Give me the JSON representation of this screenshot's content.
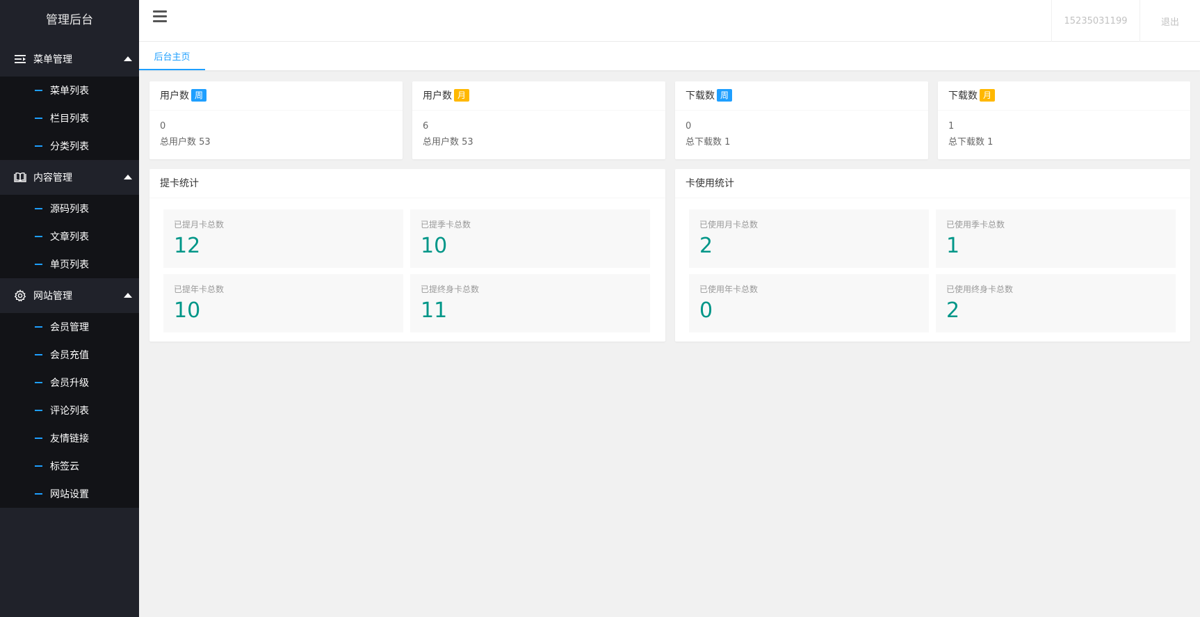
{
  "app": {
    "title": "管理后台"
  },
  "sidebar": {
    "groups": [
      {
        "label": "菜单管理",
        "icon": "menu-list-icon",
        "items": [
          "菜单列表",
          "栏目列表",
          "分类列表"
        ]
      },
      {
        "label": "内容管理",
        "icon": "book-icon",
        "items": [
          "源码列表",
          "文章列表",
          "单页列表"
        ]
      },
      {
        "label": "网站管理",
        "icon": "gear-icon",
        "items": [
          "会员管理",
          "会员充值",
          "会员升级",
          "评论列表",
          "友情链接",
          "标签云",
          "网站设置"
        ]
      }
    ]
  },
  "header": {
    "user": "15235031199",
    "logout": "退出"
  },
  "tabs": {
    "active": "后台主页"
  },
  "stats": [
    {
      "title": "用户数",
      "badge": "周",
      "badge_color": "#1e9fff",
      "value": "0",
      "total": "总用户数 53"
    },
    {
      "title": "用户数",
      "badge": "月",
      "badge_color": "#ffb800",
      "value": "6",
      "total": "总用户数 53"
    },
    {
      "title": "下载数",
      "badge": "周",
      "badge_color": "#1e9fff",
      "value": "0",
      "total": "总下载数 1"
    },
    {
      "title": "下载数",
      "badge": "月",
      "badge_color": "#ffb800",
      "value": "1",
      "total": "总下载数 1"
    }
  ],
  "card_stats": {
    "title": "提卡统计",
    "cells": [
      {
        "label": "已提月卡总数",
        "value": "12"
      },
      {
        "label": "已提季卡总数",
        "value": "10"
      },
      {
        "label": "已提年卡总数",
        "value": "10"
      },
      {
        "label": "已提终身卡总数",
        "value": "11"
      }
    ]
  },
  "usage_stats": {
    "title": "卡使用统计",
    "cells": [
      {
        "label": "已使用月卡总数",
        "value": "2"
      },
      {
        "label": "已使用季卡总数",
        "value": "1"
      },
      {
        "label": "已使用年卡总数",
        "value": "0"
      },
      {
        "label": "已使用终身卡总数",
        "value": "2"
      }
    ]
  },
  "colors": {
    "sidebar_bg": "#20222a",
    "submenu_bg": "#121317",
    "accent": "#1e9fff",
    "value_green": "#009688",
    "badge_orange": "#ffb800"
  }
}
